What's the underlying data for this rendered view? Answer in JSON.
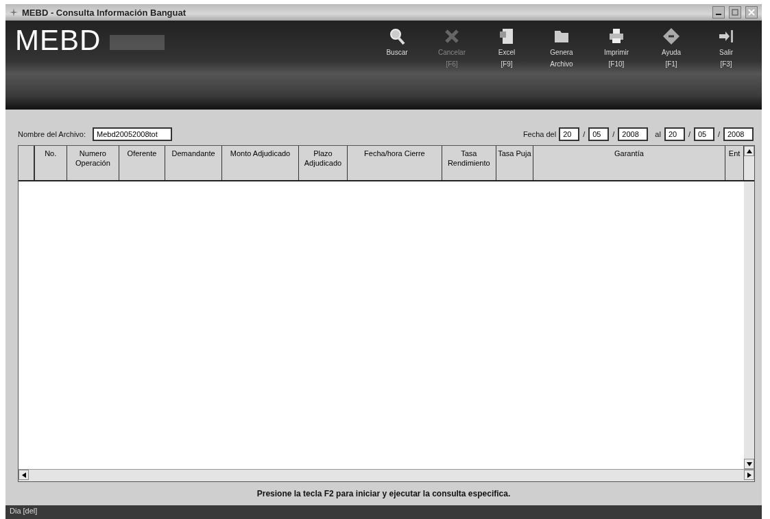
{
  "window": {
    "title": "MEBD - Consulta Información Banguat"
  },
  "logo": "MEBD",
  "toolbar": [
    {
      "kind": "search",
      "label": "Buscar",
      "disabled": false
    },
    {
      "kind": "cancel",
      "label": "Cancelar",
      "key": "[F6]",
      "disabled": true
    },
    {
      "kind": "excel",
      "label": "Excel",
      "key": "[F9]",
      "disabled": false
    },
    {
      "kind": "folder",
      "label": "Genera",
      "key": "Archivo",
      "disabled": false
    },
    {
      "kind": "print",
      "label": "Imprimir",
      "key": "[F10]",
      "disabled": false
    },
    {
      "kind": "help",
      "label": "Ayuda",
      "key": "[F1]",
      "disabled": false
    },
    {
      "kind": "exit",
      "label": "Salir",
      "key": "[F3]",
      "disabled": false
    }
  ],
  "file_field": {
    "label": "Nombre del Archivo:",
    "value": "Mebd20052008tot"
  },
  "date_range": {
    "label": "Fecha del",
    "from": [
      "20",
      "05",
      "2008"
    ],
    "separator": "/",
    "to_label": "al",
    "to": [
      "20",
      "05",
      "2008"
    ]
  },
  "table": {
    "columns": [
      "No.",
      "Numero Operación",
      "Oferente",
      "Demandante",
      "Monto Adjudicado",
      "Plazo Adjudicado",
      "Fecha/hora Cierre",
      "Tasa Rendimiento",
      "Tasa Puja",
      "Garantía",
      "Ent"
    ]
  },
  "message": "Presione la tecla F2 para iniciar y ejecutar la consulta especifica.",
  "status_bar": "Dia [del]"
}
